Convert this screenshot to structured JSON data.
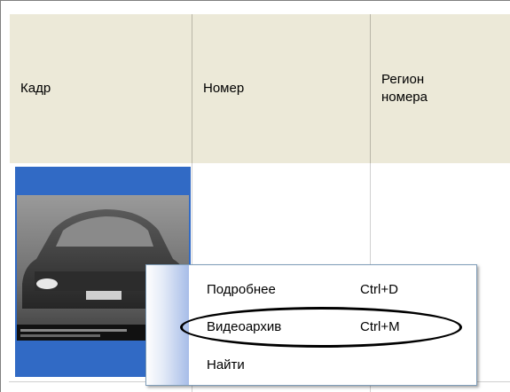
{
  "table": {
    "headers": {
      "frame": "Кадр",
      "number": "Номер",
      "region": "Регион номера"
    }
  },
  "context_menu": {
    "items": [
      {
        "label": "Подробнее",
        "shortcut": "Ctrl+D",
        "highlighted": false
      },
      {
        "label": "Видеоархив",
        "shortcut": "Ctrl+M",
        "highlighted": true
      },
      {
        "label": "Найти",
        "shortcut": "",
        "highlighted": false
      }
    ]
  },
  "colors": {
    "header_bg": "#ece9d8",
    "selection_blue": "#316ac5",
    "menu_border": "#7f9db9",
    "annotation_ellipse": "#000000"
  }
}
